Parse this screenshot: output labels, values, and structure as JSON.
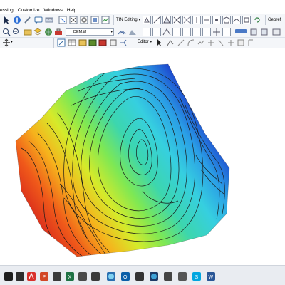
{
  "menu": {
    "items": [
      "essing",
      "Customize",
      "Windows",
      "Help"
    ]
  },
  "toolbar": {
    "tin_editing_label": "TIN Editing ▾",
    "layer_combo_value": "DEM.tif",
    "editor_label": "Editor ▾",
    "georef_label": "Georef"
  },
  "colors": {
    "surface_high": "#e03a1e",
    "surface_mid": "#3ee0c8",
    "surface_low": "#1a3ed8",
    "contour": "#1a1a1a",
    "toolbar_bg": "#f4f6f9",
    "taskbar_bg": "#e9ecf1"
  },
  "map": {
    "description_layer": "DEM contour surface",
    "contour_count": 22
  },
  "taskbar": {
    "icons": [
      "start-icon",
      "explorer-icon",
      "acrobat-icon",
      "powerpoint-icon",
      "excel-icon",
      "media-icon",
      "browser-icon",
      "outlook-icon",
      "arcmap-icon",
      "app-icon",
      "skype-icon",
      "word-icon"
    ]
  }
}
